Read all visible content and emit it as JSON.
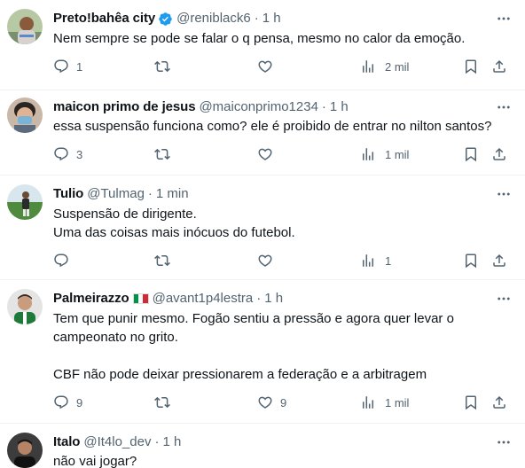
{
  "tweets": [
    {
      "name": "Preto!bahêa city",
      "handle": "@reniblack6",
      "dot": "·",
      "time": "1 h",
      "verified": true,
      "text": "Nem sempre se pode se falar o q pensa, mesmo no calor da emoção.",
      "replies": "1",
      "retweets": "",
      "likes": "",
      "views": "2 mil"
    },
    {
      "name": "maicon primo de jesus",
      "handle": "@maiconprimo1234",
      "dot": "·",
      "time": "1 h",
      "text": "essa suspensão funciona como? ele é proibido de entrar no nilton santos?",
      "replies": "3",
      "retweets": "",
      "likes": "",
      "views": "1 mil"
    },
    {
      "name": "Tulio",
      "handle": "@Tulmag",
      "dot": "·",
      "time": "1 min",
      "text": "Suspensão de dirigente.\nUma das coisas mais inócuos do futebol.",
      "replies": "",
      "retweets": "",
      "likes": "",
      "views": "1"
    },
    {
      "name": "Palmeirazzo",
      "handle": "@avant1p4lestra",
      "dot": "·",
      "time": "1 h",
      "flag": "italy-flag",
      "text": "Tem que punir mesmo. Fogão sentiu a pressão e agora quer levar o campeonato no grito.\n\nCBF não pode deixar pressionarem a federação e a arbitragem",
      "replies": "9",
      "retweets": "",
      "likes": "9",
      "views": "1 mil"
    },
    {
      "name": "Italo",
      "handle": "@It4lo_dev",
      "dot": "·",
      "time": "1 h",
      "text": "não vai jogar?"
    }
  ],
  "icons": [
    "reply-icon",
    "retweet-icon",
    "like-icon",
    "views-icon",
    "bookmark-icon",
    "share-icon",
    "more-icon",
    "verified-badge-icon"
  ],
  "colors": {
    "text": "#0f1419",
    "secondary": "#536471",
    "verified": "#1d9bf0",
    "border": "#eff3f4"
  }
}
